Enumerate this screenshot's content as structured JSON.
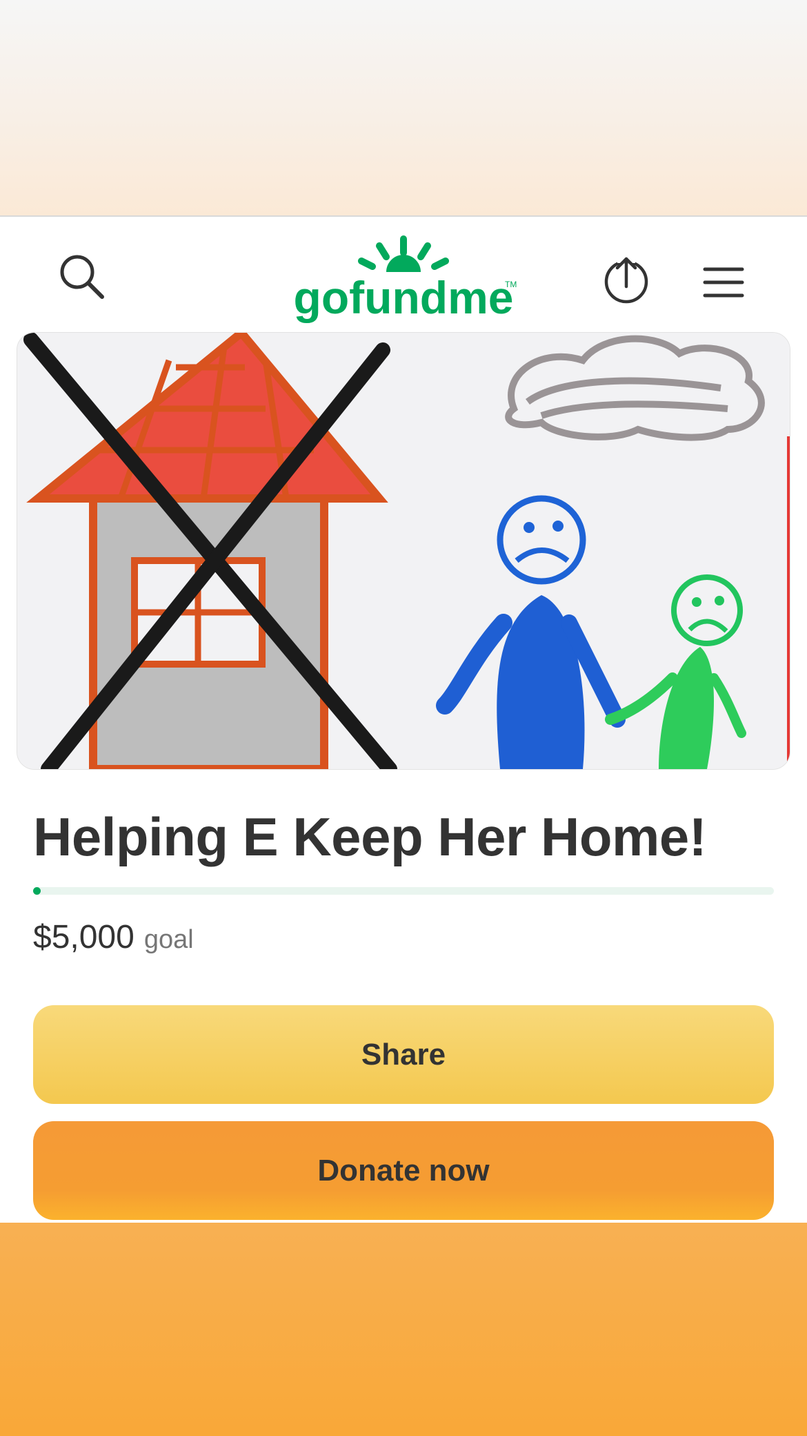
{
  "header": {
    "logo_text": "gofundme",
    "logo_trademark": "TM",
    "search_icon": "search-icon",
    "share_icon": "share-upload-icon",
    "menu_icon": "hamburger-menu-icon"
  },
  "hero": {
    "image_description_icon": "campaign-cover-image"
  },
  "campaign": {
    "title": "Helping E Keep Her Home!",
    "progress_fraction": 0.0,
    "goal_amount": "$5,000",
    "goal_label": "goal"
  },
  "actions": {
    "share_label": "Share",
    "donate_label": "Donate now"
  },
  "colors": {
    "brand_green": "#02a95c",
    "share_yellow": "#f6cf5e",
    "donate_orange": "#f59a37"
  }
}
